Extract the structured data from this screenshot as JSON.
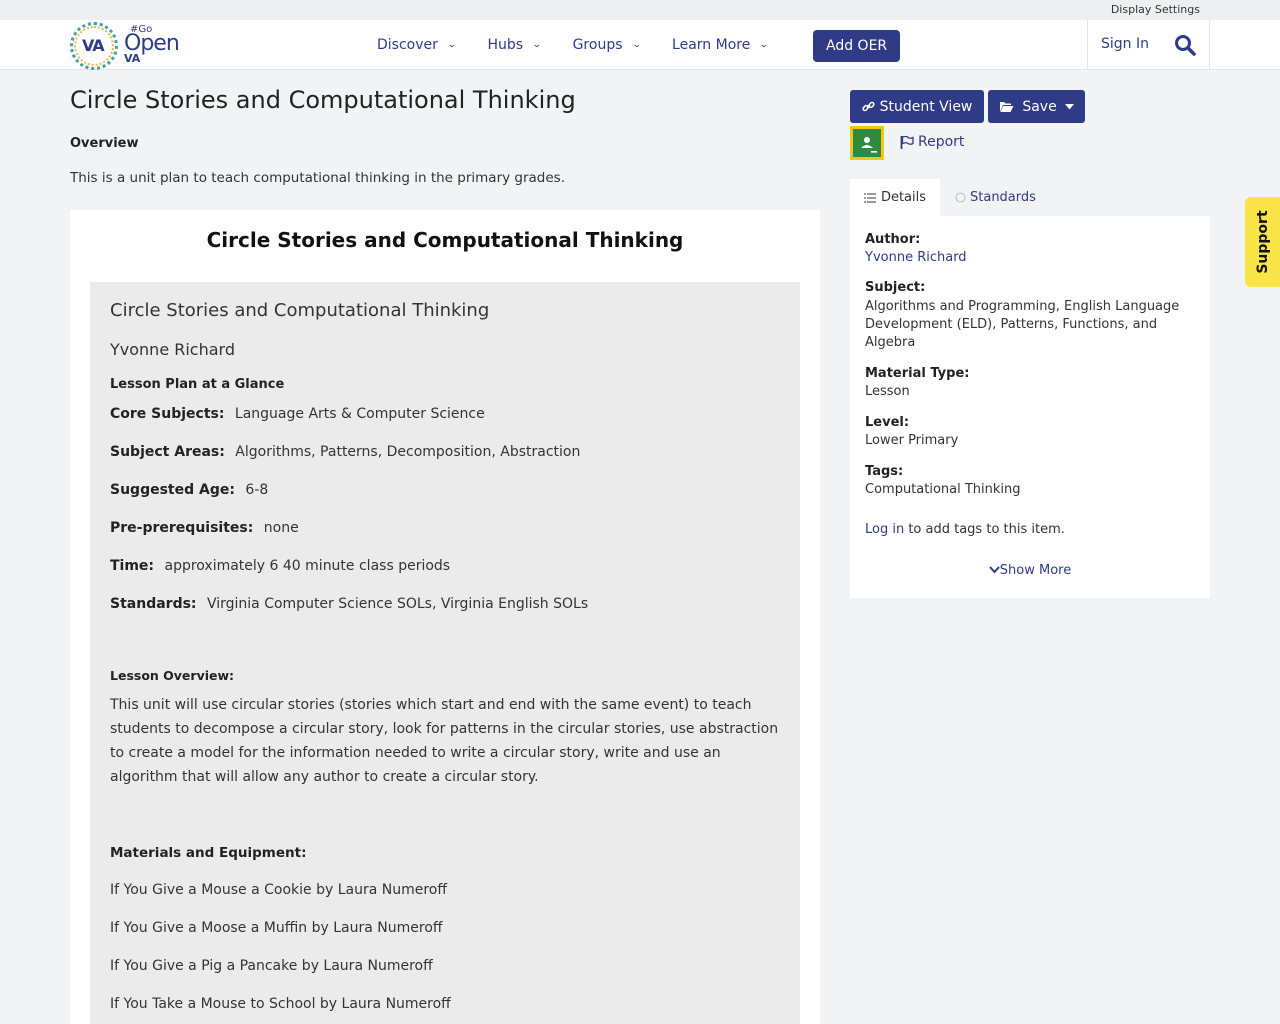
{
  "topbar": {
    "display_settings": "Display Settings"
  },
  "logo": {
    "va": "VA",
    "hash": "#Go",
    "open": "Open",
    "va2": "VA"
  },
  "nav": {
    "items": [
      {
        "label": "Discover"
      },
      {
        "label": "Hubs"
      },
      {
        "label": "Groups"
      },
      {
        "label": "Learn More"
      }
    ],
    "add_oer": "Add OER",
    "sign_in": "Sign In"
  },
  "page": {
    "title": "Circle Stories and Computational Thinking",
    "overview_heading": "Overview",
    "overview_text": "This is a unit plan to teach computational thinking in the primary grades."
  },
  "document": {
    "title": "Circle Stories and Computational Thinking",
    "inner_title": "Circle Stories and Computational Thinking",
    "author": "Yvonne Richard",
    "glance_heading": "Lesson Plan at a Glance",
    "fields": [
      {
        "label": "Core Subjects:",
        "value": "Language Arts & Computer Science"
      },
      {
        "label": "Subject Areas:",
        "value": "Algorithms, Patterns, Decomposition, Abstraction"
      },
      {
        "label": "Suggested Age:",
        "value": "6-8"
      },
      {
        "label": "Pre-prerequisites:",
        "value": "none"
      },
      {
        "label": "Time:",
        "value": "approximately 6 40 minute class periods"
      },
      {
        "label": "Standards:",
        "value": "Virginia Computer Science SOLs, Virginia English SOLs"
      }
    ],
    "lesson_overview_heading": "Lesson Overview:",
    "lesson_overview_text": "This unit will use circular stories (stories which start and end with the same event) to teach students to decompose a circular story, look for patterns in the circular stories, use abstraction to create a model for the information needed to write a circular story, write and use an algorithm that will allow any author to create a circular story.",
    "materials_heading": "Materials and Equipment:",
    "materials": [
      "If You Give a Mouse a Cookie by Laura Numeroff",
      "If You Give a Moose a Muffin by Laura Numeroff",
      "If You Give a Pig a Pancake by Laura Numeroff",
      "If You Take a Mouse to School by Laura Numeroff"
    ]
  },
  "sidebar": {
    "student_view": "Student View",
    "save": "Save",
    "report": "Report",
    "tabs": {
      "details": "Details",
      "standards": "Standards"
    },
    "author_label": "Author:",
    "author_value": "Yvonne Richard",
    "subject_label": "Subject:",
    "subject_value": "Algorithms and Programming, English Language Development (ELD), Patterns, Functions, and Algebra",
    "material_type_label": "Material Type:",
    "material_type_value": "Lesson",
    "level_label": "Level:",
    "level_value": "Lower Primary",
    "tags_label": "Tags:",
    "tags_value": "Computational Thinking",
    "login_link": "Log in",
    "login_suffix": " to add tags to this item.",
    "show_more": "Show More"
  },
  "support": {
    "label": "Support"
  },
  "colors": {
    "brand": "#2f3b86",
    "support": "#f9e547",
    "classroom_border": "#f5c518"
  }
}
